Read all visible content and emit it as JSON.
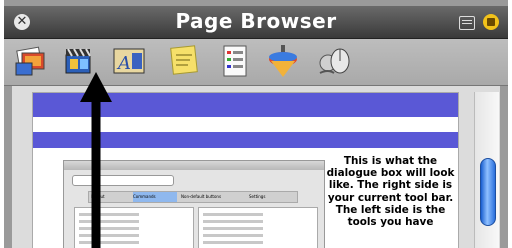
{
  "window": {
    "title": "Page Browser"
  },
  "toolbar": {
    "tools": [
      {
        "icon": "photo-stack-icon"
      },
      {
        "icon": "movie-clapper-icon"
      },
      {
        "icon": "text-frame-icon"
      },
      {
        "icon": "sticky-note-icon"
      },
      {
        "icon": "document-list-icon"
      },
      {
        "icon": "spinning-top-icon"
      },
      {
        "icon": "mouse-shapes-icon"
      }
    ]
  },
  "page": {
    "description": "This is what the dialogue box will look like. The right side is your current tool bar.  The left side is the tools you have",
    "accent_color": "#5a58d6"
  },
  "embedded_dialog": {
    "tabs": [
      "Layout",
      "Commands",
      "Non-default buttons",
      "Settings"
    ]
  },
  "colors": {
    "title_bar": "#4a4a4a",
    "toolbar": "#b4b4b4",
    "scroll_thumb": "#2a6fdc",
    "band": "#5a58d6"
  }
}
